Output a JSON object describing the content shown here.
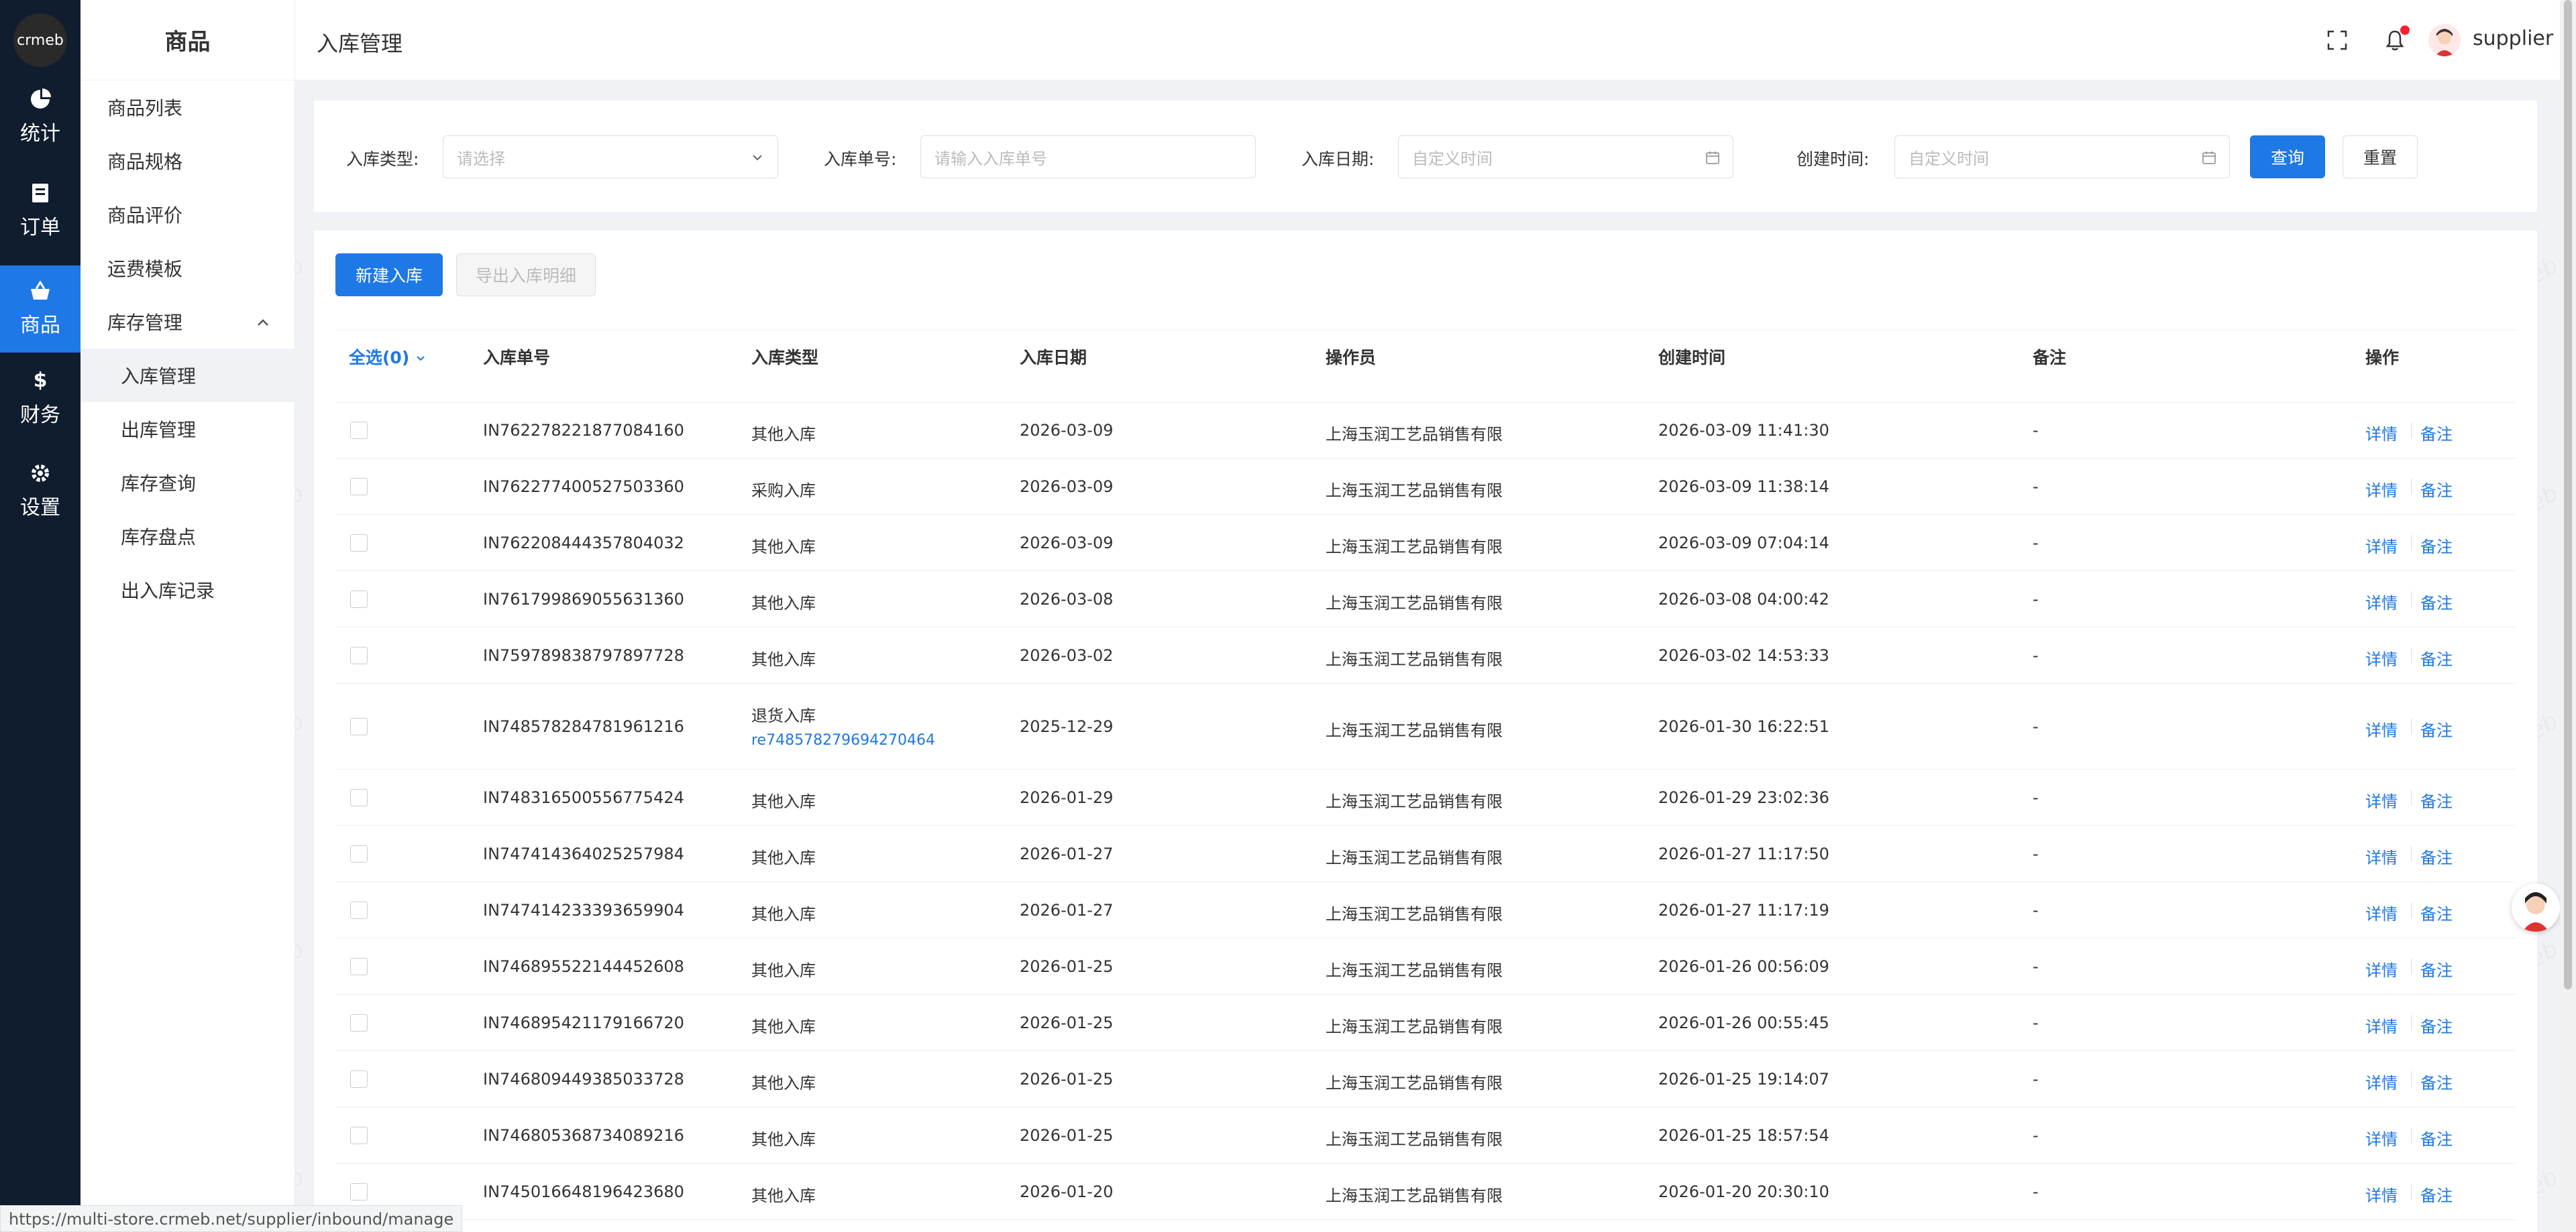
{
  "app": {
    "logo_text": "crmeb"
  },
  "rail": {
    "items": [
      {
        "label": "统计",
        "icon": "pie-chart-icon"
      },
      {
        "label": "订单",
        "icon": "document-icon"
      },
      {
        "label": "商品",
        "icon": "shopping-basket-icon"
      },
      {
        "label": "财务",
        "icon": "dollar-icon"
      },
      {
        "label": "设置",
        "icon": "gear-icon"
      }
    ],
    "active": "商品",
    "accent": "#1e78e6",
    "bg": "#0f1d2e"
  },
  "sidebar": {
    "title": "商品",
    "items": [
      {
        "label": "商品列表"
      },
      {
        "label": "商品规格"
      },
      {
        "label": "商品评价"
      },
      {
        "label": "运费模板"
      },
      {
        "label": "库存管理"
      }
    ],
    "sub_items": [
      {
        "label": "入库管理"
      },
      {
        "label": "出库管理"
      },
      {
        "label": "库存查询"
      },
      {
        "label": "库存盘点"
      },
      {
        "label": "出入库记录"
      }
    ],
    "active": "入库管理"
  },
  "header": {
    "breadcrumb": "入库管理",
    "username": "supplier",
    "icons": [
      "fullscreen-icon",
      "bell-icon"
    ]
  },
  "filters": {
    "type_label": "入库类型:",
    "type_placeholder": "请选择",
    "no_label": "入库单号:",
    "no_placeholder": "请输入入库单号",
    "date_label": "入库日期:",
    "date_placeholder": "自定义时间",
    "created_label": "创建时间:",
    "created_placeholder": "自定义时间",
    "query_btn": "查询",
    "reset_btn": "重置"
  },
  "toolbar": {
    "new_btn": "新建入库",
    "export_btn": "导出入库明细"
  },
  "table": {
    "select_all": "全选(0)",
    "columns": [
      "入库单号",
      "入库类型",
      "入库日期",
      "操作员",
      "创建时间",
      "备注",
      "操作"
    ],
    "action_detail": "详情",
    "action_note": "备注",
    "rows": [
      {
        "no": "IN762278221877084160",
        "type": "其他入库",
        "ref": "",
        "date": "2026-03-09",
        "operator": "上海玉润工艺品销售有限",
        "created": "2026-03-09 11:41:30",
        "note": "-"
      },
      {
        "no": "IN762277400527503360",
        "type": "采购入库",
        "ref": "",
        "date": "2026-03-09",
        "operator": "上海玉润工艺品销售有限",
        "created": "2026-03-09 11:38:14",
        "note": "-"
      },
      {
        "no": "IN762208444357804032",
        "type": "其他入库",
        "ref": "",
        "date": "2026-03-09",
        "operator": "上海玉润工艺品销售有限",
        "created": "2026-03-09 07:04:14",
        "note": "-"
      },
      {
        "no": "IN761799869055631360",
        "type": "其他入库",
        "ref": "",
        "date": "2026-03-08",
        "operator": "上海玉润工艺品销售有限",
        "created": "2026-03-08 04:00:42",
        "note": "-"
      },
      {
        "no": "IN759789838797897728",
        "type": "其他入库",
        "ref": "",
        "date": "2026-03-02",
        "operator": "上海玉润工艺品销售有限",
        "created": "2026-03-02 14:53:33",
        "note": "-"
      },
      {
        "no": "IN748578284781961216",
        "type": "退货入库",
        "ref": "re748578279694270464",
        "date": "2025-12-29",
        "operator": "上海玉润工艺品销售有限",
        "created": "2026-01-30 16:22:51",
        "note": "-"
      },
      {
        "no": "IN748316500556775424",
        "type": "其他入库",
        "ref": "",
        "date": "2026-01-29",
        "operator": "上海玉润工艺品销售有限",
        "created": "2026-01-29 23:02:36",
        "note": "-"
      },
      {
        "no": "IN747414364025257984",
        "type": "其他入库",
        "ref": "",
        "date": "2026-01-27",
        "operator": "上海玉润工艺品销售有限",
        "created": "2026-01-27 11:17:50",
        "note": "-"
      },
      {
        "no": "IN747414233393659904",
        "type": "其他入库",
        "ref": "",
        "date": "2026-01-27",
        "operator": "上海玉润工艺品销售有限",
        "created": "2026-01-27 11:17:19",
        "note": "-"
      },
      {
        "no": "IN746895522144452608",
        "type": "其他入库",
        "ref": "",
        "date": "2026-01-25",
        "operator": "上海玉润工艺品销售有限",
        "created": "2026-01-26 00:56:09",
        "note": "-"
      },
      {
        "no": "IN746895421179166720",
        "type": "其他入库",
        "ref": "",
        "date": "2026-01-25",
        "operator": "上海玉润工艺品销售有限",
        "created": "2026-01-26 00:55:45",
        "note": "-"
      },
      {
        "no": "IN746809449385033728",
        "type": "其他入库",
        "ref": "",
        "date": "2026-01-25",
        "operator": "上海玉润工艺品销售有限",
        "created": "2026-01-25 19:14:07",
        "note": "-"
      },
      {
        "no": "IN746805368734089216",
        "type": "其他入库",
        "ref": "",
        "date": "2026-01-25",
        "operator": "上海玉润工艺品销售有限",
        "created": "2026-01-25 18:57:54",
        "note": "-"
      },
      {
        "no": "IN745016648196423680",
        "type": "其他入库",
        "ref": "",
        "date": "2026-01-20",
        "operator": "上海玉润工艺品销售有限",
        "created": "2026-01-20 20:30:10",
        "note": "-"
      }
    ]
  },
  "status_url": "https://multi-store.crmeb.net/supplier/inbound/manage"
}
